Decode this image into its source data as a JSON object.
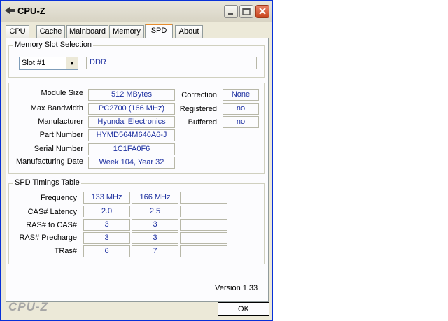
{
  "window": {
    "title": "CPU-Z"
  },
  "tabs": [
    "CPU",
    "Cache",
    "Mainboard",
    "Memory",
    "SPD",
    "About"
  ],
  "active_tab": "SPD",
  "memory_slot": {
    "group_label": "Memory Slot Selection",
    "selected_slot": "Slot #1",
    "type": "DDR"
  },
  "module": {
    "labels": {
      "module_size": "Module Size",
      "max_bandwidth": "Max Bandwidth",
      "manufacturer": "Manufacturer",
      "part_number": "Part Number",
      "serial_number": "Serial Number",
      "manufacturing_date": "Manufacturing Date",
      "correction": "Correction",
      "registered": "Registered",
      "buffered": "Buffered"
    },
    "values": {
      "module_size": "512 MBytes",
      "max_bandwidth": "PC2700 (166 MHz)",
      "manufacturer": "Hyundai Electronics",
      "part_number": "HYMD564M646A6-J",
      "serial_number": "1C1FA0F6",
      "manufacturing_date": "Week 104, Year 32",
      "correction": "None",
      "registered": "no",
      "buffered": "no"
    }
  },
  "timings": {
    "group_label": "SPD Timings Table",
    "rows": [
      {
        "label": "Frequency",
        "values": [
          "133 MHz",
          "166 MHz",
          ""
        ]
      },
      {
        "label": "CAS# Latency",
        "values": [
          "2.0",
          "2.5",
          ""
        ]
      },
      {
        "label": "RAS# to CAS#",
        "values": [
          "3",
          "3",
          ""
        ]
      },
      {
        "label": "RAS# Precharge",
        "values": [
          "3",
          "3",
          ""
        ]
      },
      {
        "label": "TRas#",
        "values": [
          "6",
          "7",
          ""
        ]
      }
    ]
  },
  "footer": {
    "version": "Version 1.33",
    "brand": "CPU-Z",
    "ok_label": "OK"
  },
  "icons": {
    "app": "cpu-z-app-icon",
    "minimize": "minimize-icon",
    "maximize": "maximize-icon",
    "close": "close-icon",
    "dropdown": "chevron-down-icon"
  }
}
